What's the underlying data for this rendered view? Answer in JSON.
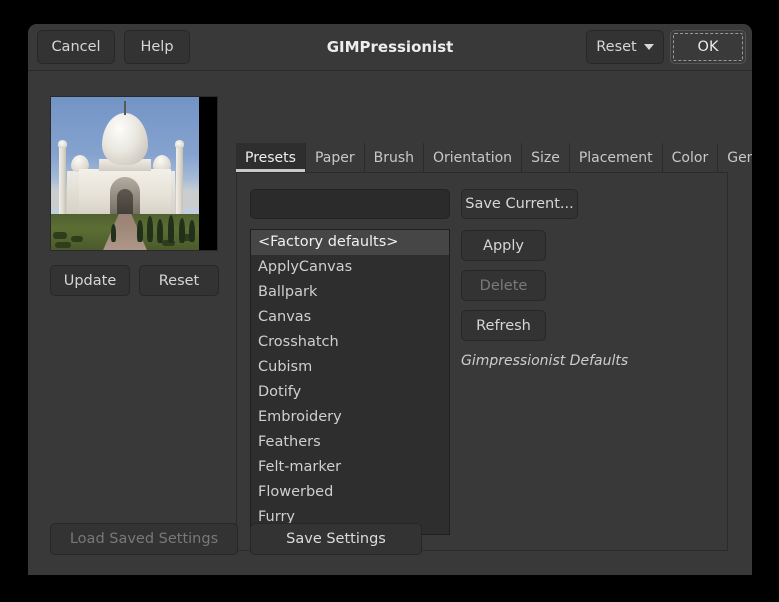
{
  "window": {
    "title": "GIMPressionist"
  },
  "header": {
    "cancel_label": "Cancel",
    "help_label": "Help",
    "reset_label": "Reset",
    "ok_label": "OK"
  },
  "preview": {
    "update_label": "Update",
    "reset_label": "Reset",
    "image_subject": "taj-mahal-photo"
  },
  "tabs": [
    {
      "label": "Presets",
      "active": true
    },
    {
      "label": "Paper",
      "active": false
    },
    {
      "label": "Brush",
      "active": false
    },
    {
      "label": "Orientation",
      "active": false
    },
    {
      "label": "Size",
      "active": false
    },
    {
      "label": "Placement",
      "active": false
    },
    {
      "label": "Color",
      "active": false
    },
    {
      "label": "General",
      "active": false
    }
  ],
  "presets_page": {
    "name_entry": {
      "value": "",
      "placeholder": ""
    },
    "list": [
      {
        "label": "<Factory defaults>",
        "selected": true
      },
      {
        "label": "ApplyCanvas",
        "selected": false
      },
      {
        "label": "Ballpark",
        "selected": false
      },
      {
        "label": "Canvas",
        "selected": false
      },
      {
        "label": "Crosshatch",
        "selected": false
      },
      {
        "label": "Cubism",
        "selected": false
      },
      {
        "label": "Dotify",
        "selected": false
      },
      {
        "label": "Embroidery",
        "selected": false
      },
      {
        "label": "Feathers",
        "selected": false
      },
      {
        "label": "Felt-marker",
        "selected": false
      },
      {
        "label": "Flowerbed",
        "selected": false
      },
      {
        "label": "Furry",
        "selected": false
      }
    ],
    "save_current_label": "Save Current...",
    "apply_label": "Apply",
    "delete_label": "Delete",
    "refresh_label": "Refresh",
    "status_text": "Gimpressionist Defaults"
  },
  "footer": {
    "load_saved_label": "Load Saved Settings",
    "save_settings_label": "Save Settings"
  },
  "colors": {
    "window_bg": "#393939",
    "panel_bg": "#2e2e2e",
    "button_bg": "#333333",
    "selection_bg": "#464646",
    "text": "#d6d6d6",
    "text_disabled": "#7a7a7a"
  }
}
